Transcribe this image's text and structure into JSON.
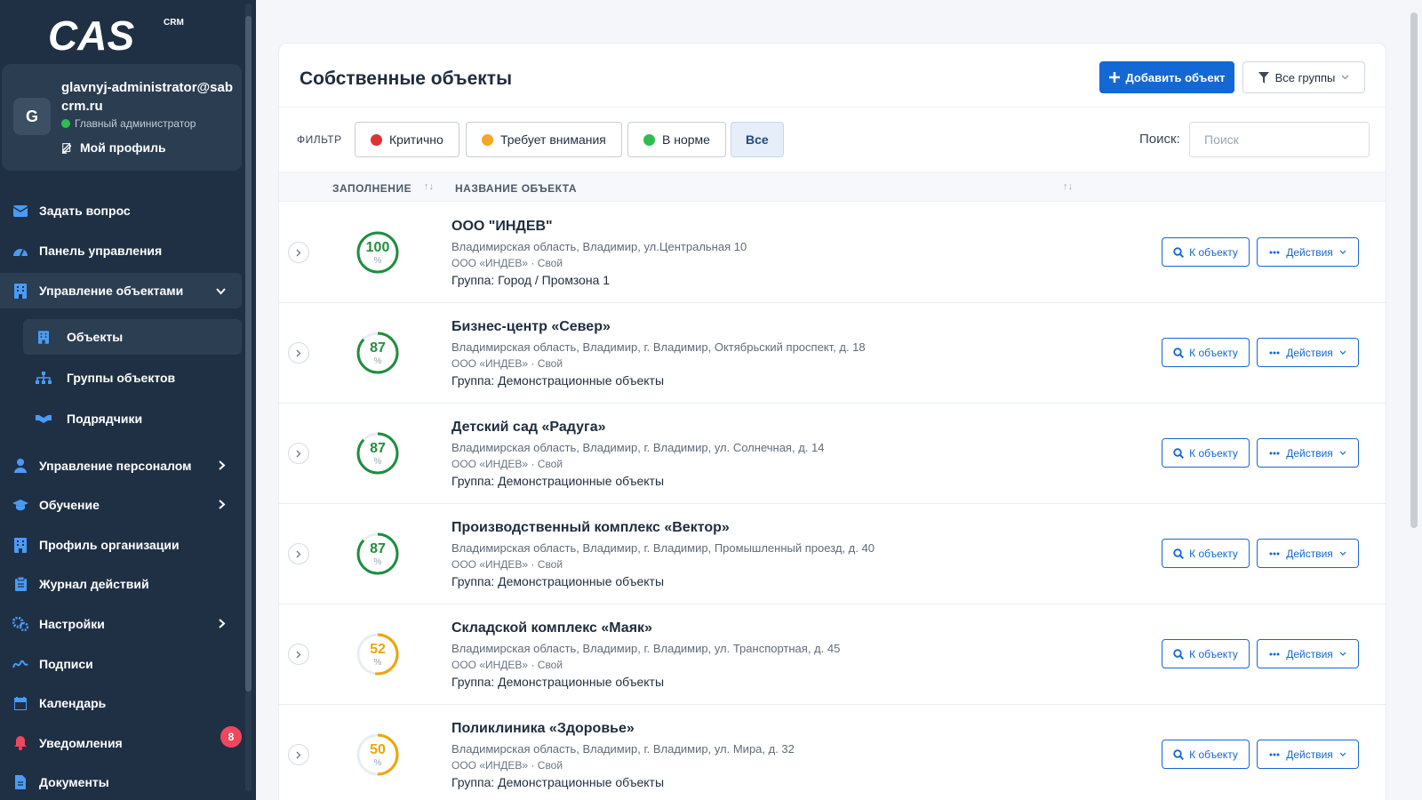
{
  "brand": {
    "logo_text": "CAS",
    "logo_sup": "CRM"
  },
  "user": {
    "initial": "G",
    "email": "glavnyj-administrator@sabcrm.ru",
    "role": "Главный администратор",
    "profile_link": "Мой профиль"
  },
  "sidebar": {
    "items": [
      {
        "label": "Задать вопрос",
        "icon": "envelope-icon"
      },
      {
        "label": "Панель управления",
        "icon": "dashboard-icon"
      },
      {
        "label": "Управление объектами",
        "icon": "building-icon"
      },
      {
        "label": "Управление персоналом",
        "icon": "user-icon"
      },
      {
        "label": "Обучение",
        "icon": "graduation-cap-icon"
      },
      {
        "label": "Профиль организации",
        "icon": "building-icon"
      },
      {
        "label": "Журнал действий",
        "icon": "clipboard-icon"
      },
      {
        "label": "Настройки",
        "icon": "gears-icon"
      },
      {
        "label": "Подписи",
        "icon": "signature-icon"
      },
      {
        "label": "Календарь",
        "icon": "calendar-icon"
      },
      {
        "label": "Уведомления",
        "icon": "bell-icon"
      },
      {
        "label": "Документы",
        "icon": "file-icon"
      }
    ],
    "subitems": [
      {
        "label": "Объекты",
        "icon": "building-icon"
      },
      {
        "label": "Группы объектов",
        "icon": "sitemap-icon"
      },
      {
        "label": "Подрядчики",
        "icon": "handshake-icon"
      }
    ],
    "notifications_badge": "8"
  },
  "page": {
    "title": "Собственные объекты",
    "add_button": "Добавить объект",
    "groups_button": "Все группы",
    "filter_label": "ФИЛЬТР",
    "filters": [
      {
        "label": "Критично",
        "color": "#e03131"
      },
      {
        "label": "Требует внимания",
        "color": "#f5a623"
      },
      {
        "label": "В норме",
        "color": "#2dbe4e"
      },
      {
        "label": "Все",
        "color": ""
      }
    ],
    "search_label": "Поиск:",
    "search_placeholder": "Поиск",
    "columns": {
      "fill": "ЗАПОЛНЕНИЕ",
      "name": "НАЗВАНИЕ ОБЪЕКТА"
    },
    "goto_label": "К объекту",
    "actions_label": "Действия",
    "pct_sign": "%"
  },
  "objects": [
    {
      "name": "ООО \"ИНДЕВ\"",
      "address": "Владимирская область, Владимир, ул.Центральная 10",
      "org": "ООО «ИНДЕВ» · Свой",
      "group": "Группа: Город / Промзона 1",
      "fill": "100",
      "fill_value": 100,
      "color": "#1e8e3e"
    },
    {
      "name": "Бизнес-центр «Север»",
      "address": "Владимирская область, Владимир, г. Владимир, Октябрьский проспект, д. 18",
      "org": "ООО «ИНДЕВ» · Свой",
      "group": "Группа: Демонстрационные объекты",
      "fill": "87",
      "fill_value": 87,
      "color": "#1e8e3e"
    },
    {
      "name": "Детский сад «Радуга»",
      "address": "Владимирская область, Владимир, г. Владимир, ул. Солнечная, д. 14",
      "org": "ООО «ИНДЕВ» · Свой",
      "group": "Группа: Демонстрационные объекты",
      "fill": "87",
      "fill_value": 87,
      "color": "#1e8e3e"
    },
    {
      "name": "Производственный комплекс «Вектор»",
      "address": "Владимирская область, Владимир, г. Владимир, Промышленный проезд, д. 40",
      "org": "ООО «ИНДЕВ» · Свой",
      "group": "Группа: Демонстрационные объекты",
      "fill": "87",
      "fill_value": 87,
      "color": "#1e8e3e"
    },
    {
      "name": "Складской комплекс «Маяк»",
      "address": "Владимирская область, Владимир, г. Владимир, ул. Транспортная, д. 45",
      "org": "ООО «ИНДЕВ» · Свой",
      "group": "Группа: Демонстрационные объекты",
      "fill": "52",
      "fill_value": 52,
      "color": "#f0a30a"
    },
    {
      "name": "Поликлиника «Здоровье»",
      "address": "Владимирская область, Владимир, г. Владимир, ул. Мира, д. 32",
      "org": "ООО «ИНДЕВ» · Свой",
      "group": "Группа: Демонстрационные объекты",
      "fill": "50",
      "fill_value": 50,
      "color": "#f0a30a"
    }
  ]
}
